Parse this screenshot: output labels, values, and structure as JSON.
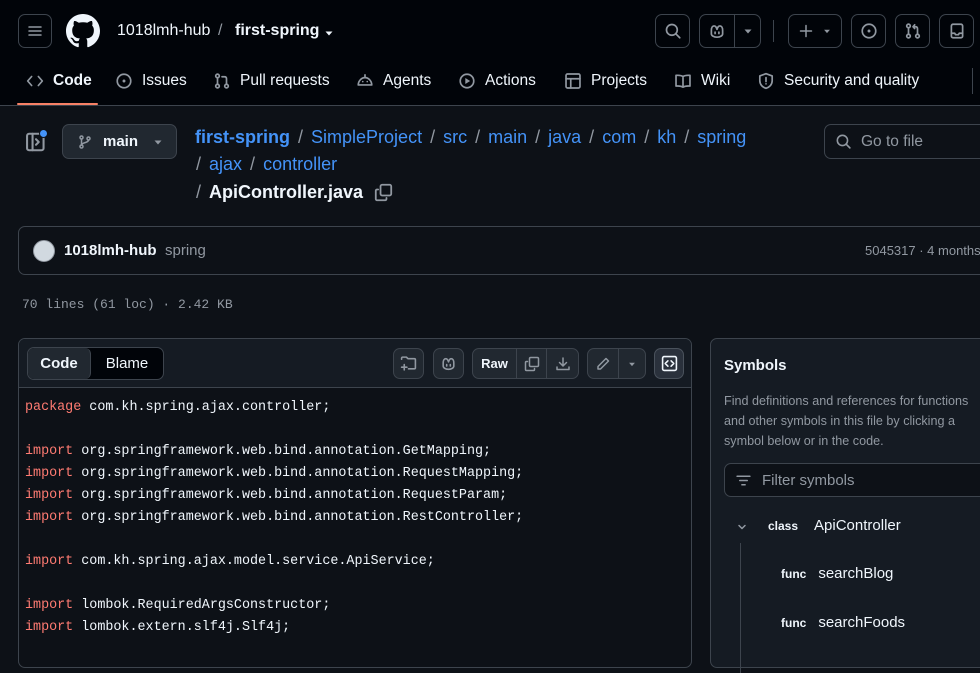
{
  "header": {
    "owner": "1018lmh-hub",
    "separator": "/",
    "repo": "first-spring",
    "tabs": [
      {
        "label": "Code",
        "icon": "code-icon"
      },
      {
        "label": "Issues",
        "icon": "issue-icon"
      },
      {
        "label": "Pull requests",
        "icon": "pull-request-icon"
      },
      {
        "label": "Agents",
        "icon": "agent-icon"
      },
      {
        "label": "Actions",
        "icon": "play-icon"
      },
      {
        "label": "Projects",
        "icon": "table-icon"
      },
      {
        "label": "Wiki",
        "icon": "book-icon"
      },
      {
        "label": "Security and quality",
        "icon": "shield-icon"
      }
    ],
    "active_tab": "Code"
  },
  "file_nav": {
    "branch": "main",
    "path": [
      "first-spring",
      "SimpleProject",
      "src",
      "main",
      "java",
      "com",
      "kh",
      "spring",
      "ajax",
      "controller"
    ],
    "file_name": "ApiController.java",
    "path_sep": "/",
    "goto_placeholder": "Go to file"
  },
  "commit": {
    "user": "1018lmh-hub",
    "message": "spring",
    "meta": "5045317 · 4 months"
  },
  "file_info": "70 lines (61 loc) · 2.42 KB",
  "toolbar": {
    "code_label": "Code",
    "blame_label": "Blame",
    "raw_label": "Raw"
  },
  "code_lines": [
    {
      "kw": "package",
      "rest": " com.kh.spring.ajax.controller;"
    },
    {
      "kw": "",
      "rest": ""
    },
    {
      "kw": "import",
      "rest": " org.springframework.web.bind.annotation.GetMapping;"
    },
    {
      "kw": "import",
      "rest": " org.springframework.web.bind.annotation.RequestMapping;"
    },
    {
      "kw": "import",
      "rest": " org.springframework.web.bind.annotation.RequestParam;"
    },
    {
      "kw": "import",
      "rest": " org.springframework.web.bind.annotation.RestController;"
    },
    {
      "kw": "",
      "rest": ""
    },
    {
      "kw": "import",
      "rest": " com.kh.spring.ajax.model.service.ApiService;"
    },
    {
      "kw": "",
      "rest": ""
    },
    {
      "kw": "import",
      "rest": " lombok.RequiredArgsConstructor;"
    },
    {
      "kw": "import",
      "rest": " lombok.extern.slf4j.Slf4j;"
    }
  ],
  "symbols": {
    "title": "Symbols",
    "description": "Find definitions and references for functions and other symbols in this file by clicking a symbol below or in the code.",
    "filter_placeholder": "Filter symbols",
    "items": [
      {
        "kind": "class",
        "name": "ApiController"
      },
      {
        "kind": "func",
        "name": "searchBlog"
      },
      {
        "kind": "func",
        "name": "searchFoods"
      }
    ]
  },
  "colors": {
    "background": "#0d1117",
    "header_bg": "#010409",
    "link": "#4493f8",
    "keyword": "#ff7b72",
    "tab_underline": "#f78166",
    "notification_dot": "#4493f8"
  }
}
